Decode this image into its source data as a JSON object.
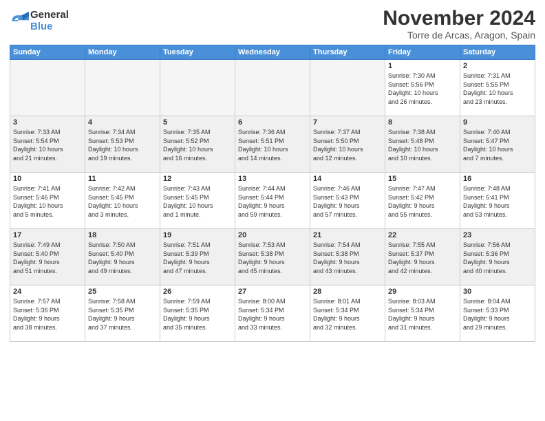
{
  "logo": {
    "general": "General",
    "blue": "Blue"
  },
  "title": {
    "month_year": "November 2024",
    "location": "Torre de Arcas, Aragon, Spain"
  },
  "headers": [
    "Sunday",
    "Monday",
    "Tuesday",
    "Wednesday",
    "Thursday",
    "Friday",
    "Saturday"
  ],
  "weeks": [
    {
      "days": [
        {
          "num": "",
          "info": "",
          "empty": true
        },
        {
          "num": "",
          "info": "",
          "empty": true
        },
        {
          "num": "",
          "info": "",
          "empty": true
        },
        {
          "num": "",
          "info": "",
          "empty": true
        },
        {
          "num": "",
          "info": "",
          "empty": true
        },
        {
          "num": "1",
          "info": "Sunrise: 7:30 AM\nSunset: 5:56 PM\nDaylight: 10 hours\nand 26 minutes.",
          "empty": false
        },
        {
          "num": "2",
          "info": "Sunrise: 7:31 AM\nSunset: 5:55 PM\nDaylight: 10 hours\nand 23 minutes.",
          "empty": false
        }
      ]
    },
    {
      "days": [
        {
          "num": "3",
          "info": "Sunrise: 7:33 AM\nSunset: 5:54 PM\nDaylight: 10 hours\nand 21 minutes.",
          "empty": false
        },
        {
          "num": "4",
          "info": "Sunrise: 7:34 AM\nSunset: 5:53 PM\nDaylight: 10 hours\nand 19 minutes.",
          "empty": false
        },
        {
          "num": "5",
          "info": "Sunrise: 7:35 AM\nSunset: 5:52 PM\nDaylight: 10 hours\nand 16 minutes.",
          "empty": false
        },
        {
          "num": "6",
          "info": "Sunrise: 7:36 AM\nSunset: 5:51 PM\nDaylight: 10 hours\nand 14 minutes.",
          "empty": false
        },
        {
          "num": "7",
          "info": "Sunrise: 7:37 AM\nSunset: 5:50 PM\nDaylight: 10 hours\nand 12 minutes.",
          "empty": false
        },
        {
          "num": "8",
          "info": "Sunrise: 7:38 AM\nSunset: 5:48 PM\nDaylight: 10 hours\nand 10 minutes.",
          "empty": false
        },
        {
          "num": "9",
          "info": "Sunrise: 7:40 AM\nSunset: 5:47 PM\nDaylight: 10 hours\nand 7 minutes.",
          "empty": false
        }
      ]
    },
    {
      "days": [
        {
          "num": "10",
          "info": "Sunrise: 7:41 AM\nSunset: 5:46 PM\nDaylight: 10 hours\nand 5 minutes.",
          "empty": false
        },
        {
          "num": "11",
          "info": "Sunrise: 7:42 AM\nSunset: 5:45 PM\nDaylight: 10 hours\nand 3 minutes.",
          "empty": false
        },
        {
          "num": "12",
          "info": "Sunrise: 7:43 AM\nSunset: 5:45 PM\nDaylight: 10 hours\nand 1 minute.",
          "empty": false
        },
        {
          "num": "13",
          "info": "Sunrise: 7:44 AM\nSunset: 5:44 PM\nDaylight: 9 hours\nand 59 minutes.",
          "empty": false
        },
        {
          "num": "14",
          "info": "Sunrise: 7:46 AM\nSunset: 5:43 PM\nDaylight: 9 hours\nand 57 minutes.",
          "empty": false
        },
        {
          "num": "15",
          "info": "Sunrise: 7:47 AM\nSunset: 5:42 PM\nDaylight: 9 hours\nand 55 minutes.",
          "empty": false
        },
        {
          "num": "16",
          "info": "Sunrise: 7:48 AM\nSunset: 5:41 PM\nDaylight: 9 hours\nand 53 minutes.",
          "empty": false
        }
      ]
    },
    {
      "days": [
        {
          "num": "17",
          "info": "Sunrise: 7:49 AM\nSunset: 5:40 PM\nDaylight: 9 hours\nand 51 minutes.",
          "empty": false
        },
        {
          "num": "18",
          "info": "Sunrise: 7:50 AM\nSunset: 5:40 PM\nDaylight: 9 hours\nand 49 minutes.",
          "empty": false
        },
        {
          "num": "19",
          "info": "Sunrise: 7:51 AM\nSunset: 5:39 PM\nDaylight: 9 hours\nand 47 minutes.",
          "empty": false
        },
        {
          "num": "20",
          "info": "Sunrise: 7:53 AM\nSunset: 5:38 PM\nDaylight: 9 hours\nand 45 minutes.",
          "empty": false
        },
        {
          "num": "21",
          "info": "Sunrise: 7:54 AM\nSunset: 5:38 PM\nDaylight: 9 hours\nand 43 minutes.",
          "empty": false
        },
        {
          "num": "22",
          "info": "Sunrise: 7:55 AM\nSunset: 5:37 PM\nDaylight: 9 hours\nand 42 minutes.",
          "empty": false
        },
        {
          "num": "23",
          "info": "Sunrise: 7:56 AM\nSunset: 5:36 PM\nDaylight: 9 hours\nand 40 minutes.",
          "empty": false
        }
      ]
    },
    {
      "days": [
        {
          "num": "24",
          "info": "Sunrise: 7:57 AM\nSunset: 5:36 PM\nDaylight: 9 hours\nand 38 minutes.",
          "empty": false
        },
        {
          "num": "25",
          "info": "Sunrise: 7:58 AM\nSunset: 5:35 PM\nDaylight: 9 hours\nand 37 minutes.",
          "empty": false
        },
        {
          "num": "26",
          "info": "Sunrise: 7:59 AM\nSunset: 5:35 PM\nDaylight: 9 hours\nand 35 minutes.",
          "empty": false
        },
        {
          "num": "27",
          "info": "Sunrise: 8:00 AM\nSunset: 5:34 PM\nDaylight: 9 hours\nand 33 minutes.",
          "empty": false
        },
        {
          "num": "28",
          "info": "Sunrise: 8:01 AM\nSunset: 5:34 PM\nDaylight: 9 hours\nand 32 minutes.",
          "empty": false
        },
        {
          "num": "29",
          "info": "Sunrise: 8:03 AM\nSunset: 5:34 PM\nDaylight: 9 hours\nand 31 minutes.",
          "empty": false
        },
        {
          "num": "30",
          "info": "Sunrise: 8:04 AM\nSunset: 5:33 PM\nDaylight: 9 hours\nand 29 minutes.",
          "empty": false
        }
      ]
    }
  ]
}
